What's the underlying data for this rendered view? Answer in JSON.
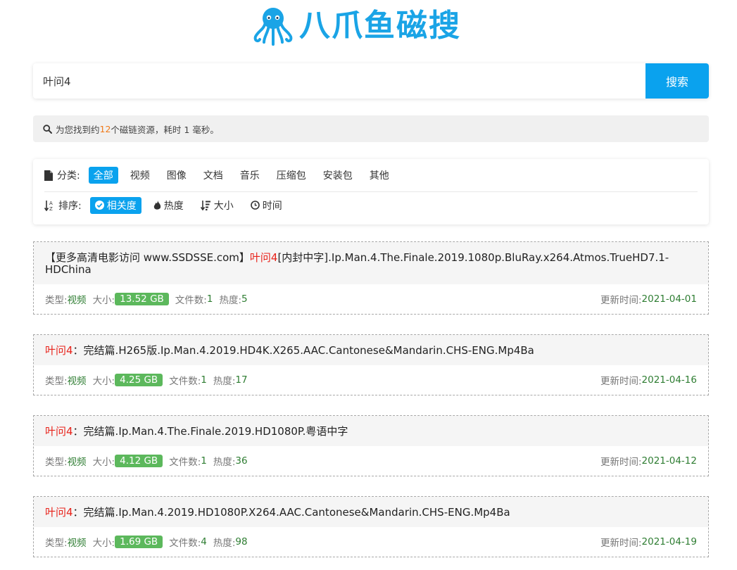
{
  "logo": {
    "text": "八爪鱼磁搜"
  },
  "search": {
    "value": "叶问4",
    "button_label": "搜索"
  },
  "info": {
    "prefix": "为您找到约",
    "count": "12",
    "suffix": "个磁链资源，耗时 1 毫秒。"
  },
  "filters": {
    "category_label": "分类:",
    "categories": [
      "全部",
      "视频",
      "图像",
      "文档",
      "音乐",
      "压缩包",
      "安装包",
      "其他"
    ],
    "active_category": "全部",
    "sort_label": "排序:",
    "sorts": [
      {
        "label": "相关度",
        "icon": "check-circle-icon"
      },
      {
        "label": "热度",
        "icon": "fire-icon"
      },
      {
        "label": "大小",
        "icon": "sort-size-icon"
      },
      {
        "label": "时间",
        "icon": "clock-icon"
      }
    ],
    "active_sort": "相关度"
  },
  "labels": {
    "type": "类型:",
    "size": "大小:",
    "files": "文件数:",
    "heat": "热度:",
    "updated": "更新时间:"
  },
  "results": [
    {
      "title_pre": "【更多高清电影访问 www.SSDSSE.com】",
      "title_kw": "叶问4",
      "title_post": "[内封中字].Ip.Man.4.The.Finale.2019.1080p.BluRay.x264.Atmos.TrueHD7.1-HDChina",
      "type": "视频",
      "size": "13.52 GB",
      "files": "1",
      "heat": "5",
      "date": "2021-04-01"
    },
    {
      "title_pre": "",
      "title_kw": "叶问4",
      "title_post": "：完结篇.H265版.Ip.Man.4.2019.HD4K.X265.AAC.Cantonese&Mandarin.CHS-ENG.Mp4Ba",
      "type": "视频",
      "size": "4.25 GB",
      "files": "1",
      "heat": "17",
      "date": "2021-04-16"
    },
    {
      "title_pre": "",
      "title_kw": "叶问4",
      "title_post": "：完结篇.Ip.Man.4.The.Finale.2019.HD1080P.粤语中字",
      "type": "视频",
      "size": "4.12 GB",
      "files": "1",
      "heat": "36",
      "date": "2021-04-12"
    },
    {
      "title_pre": "",
      "title_kw": "叶问4",
      "title_post": "：完结篇.Ip.Man.4.2019.HD1080P.X264.AAC.Cantonese&Mandarin.CHS-ENG.Mp4Ba",
      "type": "视频",
      "size": "1.69 GB",
      "files": "4",
      "heat": "98",
      "date": "2021-04-19"
    }
  ]
}
